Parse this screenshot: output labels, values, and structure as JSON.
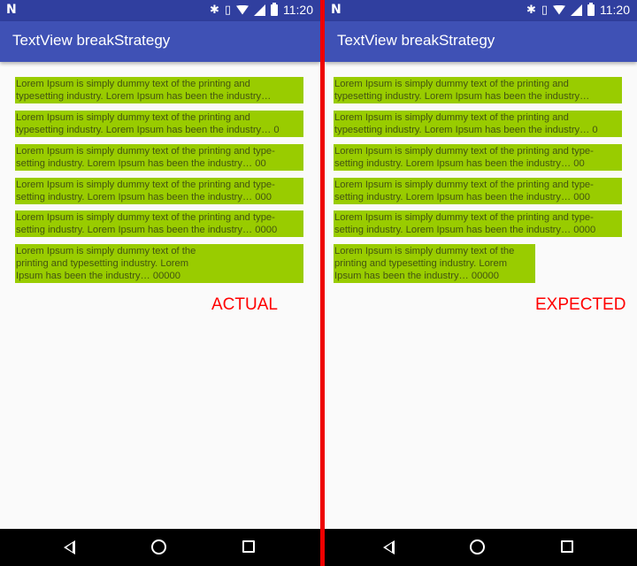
{
  "status_bar": {
    "time": "11:20",
    "notification_icon": "N"
  },
  "panels": [
    {
      "app_title": "TextView breakStrategy",
      "label": "ACTUAL",
      "textviews": [
        "Lorem Ipsum is simply dummy text of the printing and\ntypesetting industry. Lorem Ipsum has been the industry…",
        "Lorem Ipsum is simply dummy text of the printing and\ntypesetting industry. Lorem Ipsum has been the industry… 0",
        "Lorem Ipsum is simply dummy text of the printing and type-\nsetting industry. Lorem Ipsum has been the industry… 00",
        "Lorem Ipsum is simply dummy text of the printing and type-\nsetting industry. Lorem Ipsum has been the industry… 000",
        "Lorem Ipsum is simply dummy text of the printing and type-\nsetting industry. Lorem Ipsum has been the industry… 0000",
        "Lorem Ipsum is simply dummy text of the\nprinting and typesetting industry. Lorem\nIpsum has been the industry… 00000"
      ]
    },
    {
      "app_title": "TextView breakStrategy",
      "label": "EXPECTED",
      "textviews": [
        "Lorem Ipsum is simply dummy text of the printing and\ntypesetting industry. Lorem Ipsum has been the industry…",
        "Lorem Ipsum is simply dummy text of the printing and\ntypesetting industry. Lorem Ipsum has been the industry… 0",
        "Lorem Ipsum is simply dummy text of the printing and type-\nsetting industry. Lorem Ipsum has been the industry… 00",
        "Lorem Ipsum is simply dummy text of the printing and type-\nsetting industry. Lorem Ipsum has been the industry… 000",
        "Lorem Ipsum is simply dummy text of the printing and type-\nsetting industry. Lorem Ipsum has been the industry… 0000",
        "Lorem Ipsum is simply dummy text of the\nprinting and typesetting industry. Lorem\nIpsum has been the industry… 00000"
      ]
    }
  ],
  "colors": {
    "status_bar": "#303f9f",
    "app_bar": "#3f51b5",
    "textview_bg": "#99cc00",
    "label": "#ff0000",
    "divider": "#ee0000"
  },
  "icons": [
    "bluetooth-icon",
    "vibrate-icon",
    "wifi-icon",
    "signal-icon",
    "battery-icon",
    "back-icon",
    "home-icon",
    "recents-icon"
  ]
}
